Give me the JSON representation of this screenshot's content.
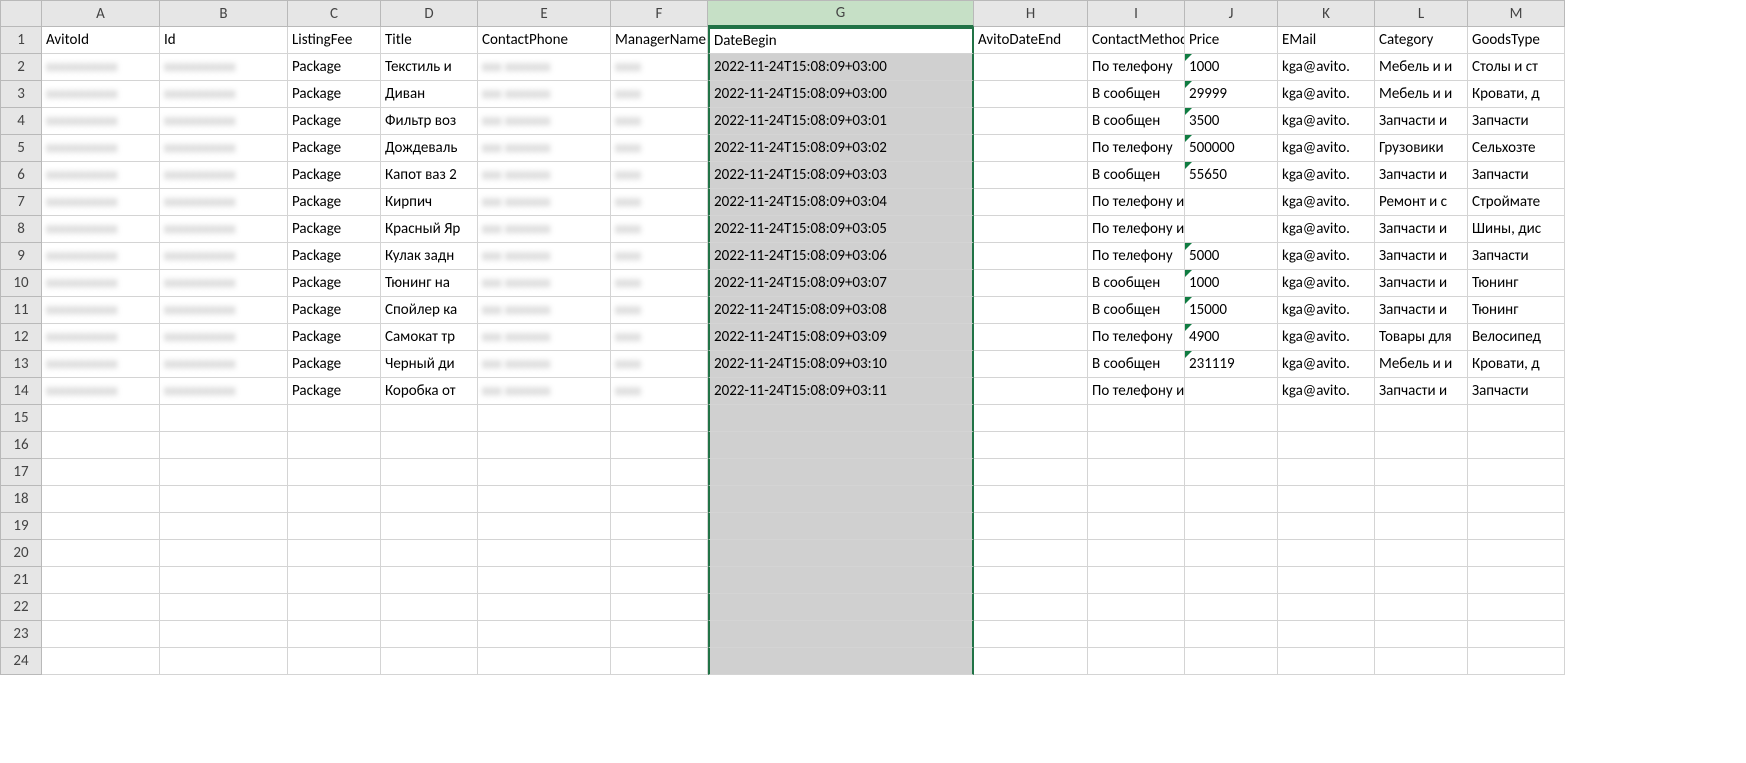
{
  "columns": [
    "A",
    "B",
    "C",
    "D",
    "E",
    "F",
    "G",
    "H",
    "I",
    "J",
    "K",
    "L",
    "M"
  ],
  "selected_column": "G",
  "row_count": 24,
  "headers": {
    "A": "AvitoId",
    "B": "Id",
    "C": "ListingFee",
    "D": "Title",
    "E": "ContactPhone",
    "F": "ManagerName",
    "G": "DateBegin",
    "H": "AvitoDateEnd",
    "I": "ContactMethod",
    "J": "Price",
    "K": "EMail",
    "L": "Category",
    "M": "GoodsType"
  },
  "rows": [
    {
      "A": "",
      "B": "",
      "C": "Package",
      "D": "Текстиль и",
      "E": "",
      "F": "",
      "G": "2022-11-24T15:08:09+03:00",
      "H": "",
      "I": "По телефону",
      "J": "1000",
      "K": "kga@avito.",
      "L": "Мебель и и",
      "M": "Столы и ст"
    },
    {
      "A": "",
      "B": "",
      "C": "Package",
      "D": "Диван",
      "E": "",
      "F": "",
      "G": "2022-11-24T15:08:09+03:00",
      "H": "",
      "I": "В сообщен",
      "J": "29999",
      "K": "kga@avito.",
      "L": "Мебель и и",
      "M": "Кровати, д"
    },
    {
      "A": "",
      "B": "",
      "C": "Package",
      "D": "Фильтр воз",
      "E": "",
      "F": "",
      "G": "2022-11-24T15:08:09+03:01",
      "H": "",
      "I": "В сообщен",
      "J": "3500",
      "K": "kga@avito.",
      "L": "Запчасти и",
      "M": "Запчасти"
    },
    {
      "A": "",
      "B": "",
      "C": "Package",
      "D": "Дождеваль",
      "E": "",
      "F": "",
      "G": "2022-11-24T15:08:09+03:02",
      "H": "",
      "I": "По телефону",
      "J": "500000",
      "K": "kga@avito.",
      "L": "Грузовики",
      "M": "Сельхозте"
    },
    {
      "A": "",
      "B": "",
      "C": "Package",
      "D": "Капот ваз 2",
      "E": "",
      "F": "",
      "G": "2022-11-24T15:08:09+03:03",
      "H": "",
      "I": "В сообщен",
      "J": "55650",
      "K": "kga@avito.",
      "L": "Запчасти и",
      "M": "Запчасти"
    },
    {
      "A": "",
      "B": "",
      "C": "Package",
      "D": "Кирпич",
      "E": "",
      "F": "",
      "G": "2022-11-24T15:08:09+03:04",
      "H": "",
      "I": "По телефону и в сообщ",
      "J": "",
      "K": "kga@avito.",
      "L": "Ремонт и с",
      "M": "Строймате"
    },
    {
      "A": "",
      "B": "",
      "C": "Package",
      "D": "Красный Яр",
      "E": "",
      "F": "",
      "G": "2022-11-24T15:08:09+03:05",
      "H": "",
      "I": "По телефону и в сообщ",
      "J": "",
      "K": "kga@avito.",
      "L": "Запчасти и",
      "M": "Шины, дис"
    },
    {
      "A": "",
      "B": "",
      "C": "Package",
      "D": "Кулак задн",
      "E": "",
      "F": "",
      "G": "2022-11-24T15:08:09+03:06",
      "H": "",
      "I": "По телефону",
      "J": "5000",
      "K": "kga@avito.",
      "L": "Запчасти и",
      "M": "Запчасти"
    },
    {
      "A": "",
      "B": "",
      "C": "Package",
      "D": "Тюнинг на",
      "E": "",
      "F": "",
      "G": "2022-11-24T15:08:09+03:07",
      "H": "",
      "I": "В сообщен",
      "J": "1000",
      "K": "kga@avito.",
      "L": "Запчасти и",
      "M": "Тюнинг"
    },
    {
      "A": "",
      "B": "",
      "C": "Package",
      "D": "Спойлер ка",
      "E": "",
      "F": "",
      "G": "2022-11-24T15:08:09+03:08",
      "H": "",
      "I": "В сообщен",
      "J": "15000",
      "K": "kga@avito.",
      "L": "Запчасти и",
      "M": "Тюнинг"
    },
    {
      "A": "",
      "B": "",
      "C": "Package",
      "D": "Самокат тр",
      "E": "",
      "F": "",
      "G": "2022-11-24T15:08:09+03:09",
      "H": "",
      "I": "По телефону",
      "J": "4900",
      "K": "kga@avito.",
      "L": "Товары для",
      "M": "Велосипед"
    },
    {
      "A": "",
      "B": "",
      "C": "Package",
      "D": "Черный ди",
      "E": "",
      "F": "",
      "G": "2022-11-24T15:08:09+03:10",
      "H": "",
      "I": "В сообщен",
      "J": "231119",
      "K": "kga@avito.",
      "L": "Мебель и и",
      "M": "Кровати, д"
    },
    {
      "A": "",
      "B": "",
      "C": "Package",
      "D": "Коробка от",
      "E": "",
      "F": "",
      "G": "2022-11-24T15:08:09+03:11",
      "H": "",
      "I": "По телефону и в сообщ",
      "J": "",
      "K": "kga@avito.",
      "L": "Запчасти и",
      "M": "Запчасти"
    }
  ],
  "blurred_placeholder_A": "xxxxxxxxxxx",
  "blurred_placeholder_B": "xxxxxxxxxxx",
  "blurred_placeholder_E": "xxx xxxxxxx",
  "blurred_placeholder_F": "xxxx"
}
